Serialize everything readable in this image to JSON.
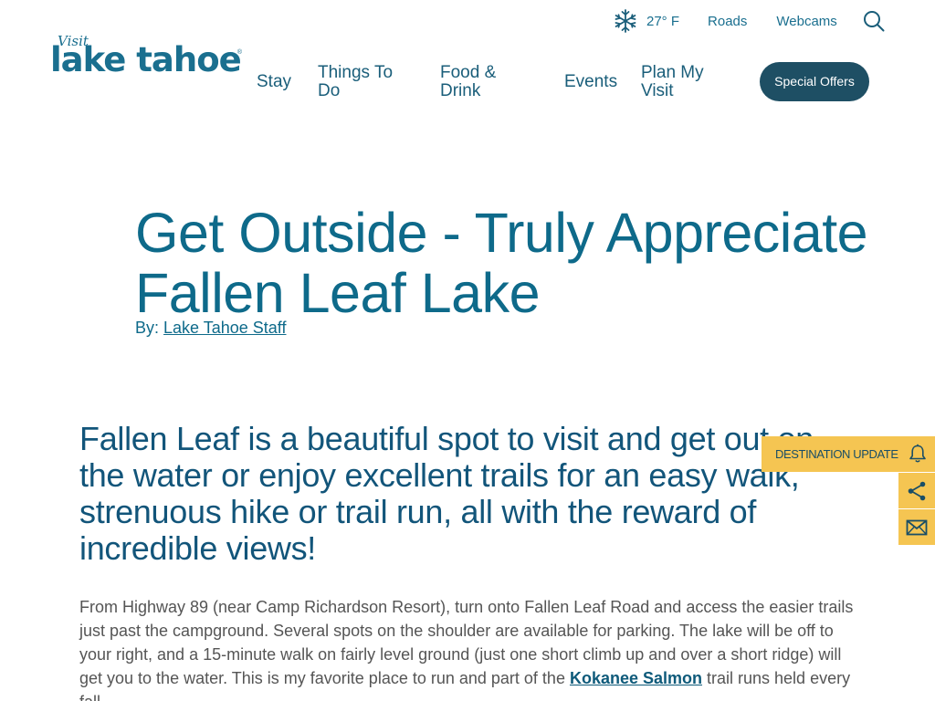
{
  "header": {
    "logo": {
      "visit": "Visit",
      "name": "lake tahoe",
      "reg": "®"
    },
    "weather": {
      "temperature": "27° F",
      "icon": "snowflake-icon"
    },
    "util_links": {
      "roads": "Roads",
      "webcams": "Webcams"
    },
    "search_icon": "search-icon",
    "nav": {
      "stay": "Stay",
      "things_to_do": "Things To Do",
      "food_drink": "Food & Drink",
      "events": "Events",
      "plan_my_visit": "Plan My Visit"
    },
    "special_offers": "Special Offers"
  },
  "article": {
    "title": "Get Outside - Truly Appreciate Fallen Leaf Lake",
    "byline_prefix": "By:",
    "author": "Lake Tahoe Staff",
    "lead": "Fallen Leaf is a beautiful spot to visit and get out on the water or enjoy excellent trails for an easy walk, strenuous hike or trail run, all with the reward of incredible views!",
    "body_part1": "From Highway 89 (near Camp Richardson Resort), turn onto Fallen Leaf Road and access the easier trails just past the campground.  Several spots on the shoulder are available for parking.  The lake will be off to your right, and a 15-minute walk on fairly level ground (just one short climb up and over a short ridge) will get you to the water. This is my favorite place to run and part of the ",
    "body_link": "Kokanee Salmon",
    "body_part2": " trail runs held every fall."
  },
  "widgets": {
    "destination_update": "DESTINATION UPDATE",
    "icons": {
      "bell": "bell-icon",
      "share": "share-icon",
      "mail": "mail-icon"
    }
  },
  "colors": {
    "brand_teal": "#0e6a8a",
    "dark_button": "#1e4f64",
    "widget_yellow": "#f5c552"
  }
}
